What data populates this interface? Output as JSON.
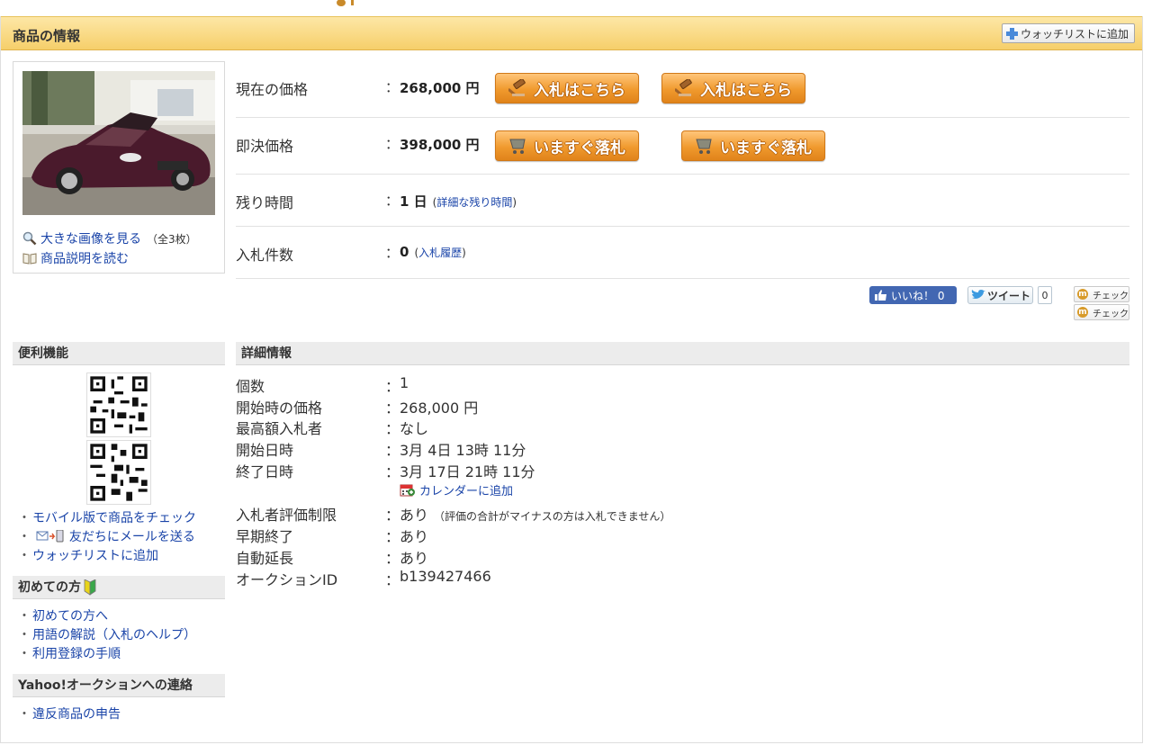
{
  "header": {
    "title": "商品の情報",
    "watch_button": "ウォッチリストに追加"
  },
  "photo": {
    "large_image_link": "大きな画像を見る",
    "image_count": "（全3枚）",
    "description_link": "商品説明を読む"
  },
  "price": {
    "current_label": "現在の価格",
    "current_value": "268,000 円",
    "bid_button_1": "入札はこちら",
    "bid_button_2": "入札はこちら"
  },
  "buyout": {
    "label": "即決価格",
    "value": "398,000 円",
    "buy_button_1": "いますぐ落札",
    "buy_button_2": "いますぐ落札"
  },
  "time_left": {
    "label": "残り時間",
    "value": "1 日",
    "detail_link": "詳細な残り時間"
  },
  "bids": {
    "label": "入札件数",
    "value": "0",
    "history_link": "入札履歴"
  },
  "social": {
    "like": "いいね！ 0",
    "tweet": "ツイート",
    "tweet_count": "0",
    "check_1": "チェック",
    "check_2": "チェック"
  },
  "colors": {
    "header_bg": "#f6cf6a",
    "orange_button": "#f09a2e",
    "link": "#1a44a8",
    "facebook": "#4267b2"
  },
  "sidebar": {
    "convenience_title": "便利機能",
    "convenience_links": [
      "モバイル版で商品をチェック",
      "友だちにメールを送る",
      "ウォッチリストに追加"
    ],
    "beginner_title": "初めての方",
    "beginner_links": [
      "初めての方へ",
      "用語の解説（入札のヘルプ）",
      "利用登録の手順"
    ],
    "contact_title": "Yahoo!オークションへの連絡",
    "contact_links": [
      "違反商品の申告"
    ]
  },
  "detail": {
    "title": "詳細情報",
    "rows": [
      {
        "label": "個数",
        "value": "1"
      },
      {
        "label": "開始時の価格",
        "value": "268,000 円"
      },
      {
        "label": "最高額入札者",
        "value": "なし"
      },
      {
        "label": "開始日時",
        "value": "3月 4日 13時 11分"
      },
      {
        "label": "終了日時",
        "value": "3月 17日 21時 11分"
      },
      {
        "label": "入札者評価制限",
        "value": "あり",
        "note": "（評価の合計がマイナスの方は入札できません）"
      },
      {
        "label": "早期終了",
        "value": "あり"
      },
      {
        "label": "自動延長",
        "value": "あり"
      },
      {
        "label": "オークションID",
        "value": "b139427466"
      }
    ],
    "calendar_link": "カレンダーに追加"
  }
}
